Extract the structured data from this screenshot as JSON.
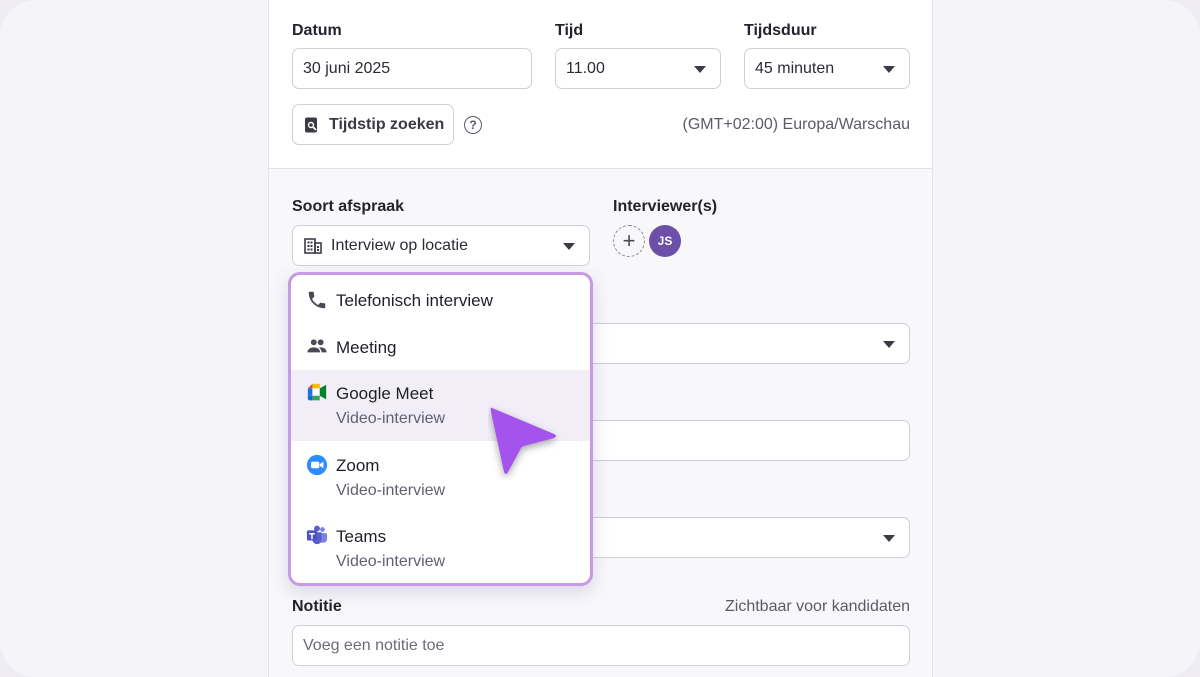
{
  "form": {
    "date_label": "Datum",
    "date_value": "30 juni 2025",
    "time_label": "Tijd",
    "time_value": "11.00",
    "duration_label": "Tijdsduur",
    "duration_value": "45 minuten",
    "search_time_label": "Tijdstip zoeken",
    "help_glyph": "?",
    "timezone": "(GMT+02:00) Europa/Warschau",
    "type_label": "Soort afspraak",
    "type_value": "Interview op locatie",
    "interviewers_label": "Interviewer(s)",
    "add_interviewer_glyph": "+",
    "interviewer_initials": "JS",
    "note_label": "Notitie",
    "note_visibility": "Zichtbaar voor kandidaten",
    "note_placeholder": "Voeg een notitie toe"
  },
  "dropdown": {
    "options": [
      {
        "title": "Telefonisch interview",
        "icon": "phone-icon"
      },
      {
        "title": "Meeting",
        "icon": "people-icon"
      },
      {
        "title": "Google Meet",
        "subtitle": "Video-interview",
        "icon": "google-meet-icon",
        "highlighted": true
      },
      {
        "title": "Zoom",
        "subtitle": "Video-interview",
        "icon": "zoom-icon"
      },
      {
        "title": "Teams",
        "subtitle": "Video-interview",
        "icon": "teams-icon"
      }
    ]
  },
  "colors": {
    "accent": "#c79be3",
    "cursor": "#a453ec",
    "avatar": "#6b4fa8",
    "zoom": "#2d8cff",
    "teams": "#5b5fc7"
  }
}
